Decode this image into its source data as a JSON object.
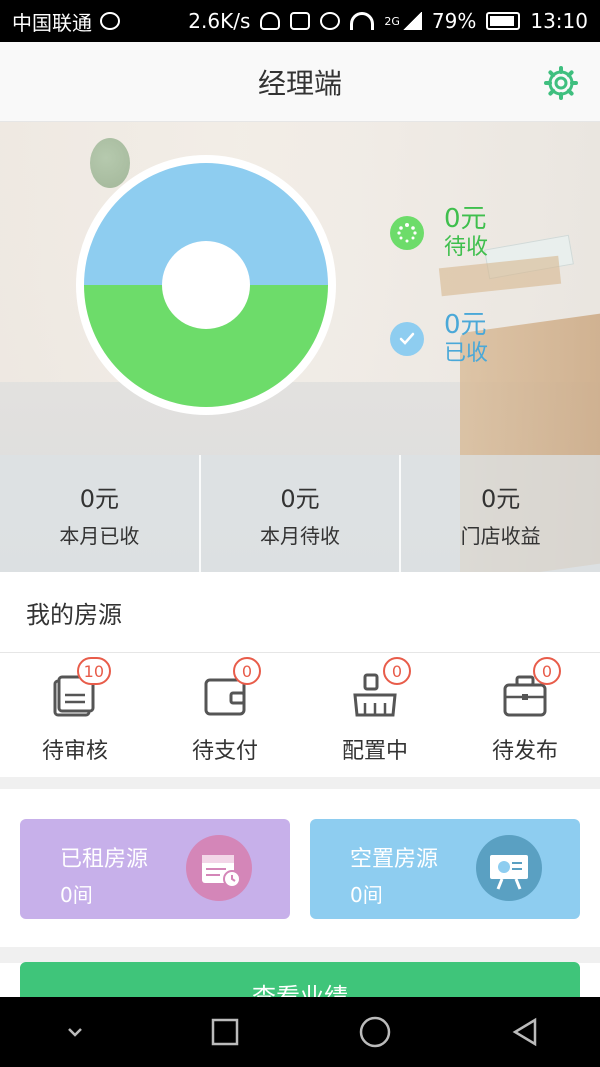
{
  "status_bar": {
    "carrier": "中国联通",
    "speed": "2.6K/s",
    "network": "2G",
    "battery": "79%",
    "time": "13:10"
  },
  "header": {
    "title": "经理端"
  },
  "summary": {
    "pending_value": "0元",
    "pending_label": "待收",
    "received_value": "0元",
    "received_label": "已收",
    "colors": {
      "pending": "#6ddc6a",
      "received": "#8ecdf0"
    }
  },
  "stats": [
    {
      "value": "0元",
      "label": "本月已收"
    },
    {
      "value": "0元",
      "label": "本月待收"
    },
    {
      "value": "0元",
      "label": "门店收益"
    }
  ],
  "section": {
    "my_listings": "我的房源"
  },
  "quick_actions": [
    {
      "label": "待审核",
      "badge": "10",
      "icon": "document-icon"
    },
    {
      "label": "待支付",
      "badge": "0",
      "icon": "wallet-icon"
    },
    {
      "label": "配置中",
      "badge": "0",
      "icon": "broom-icon"
    },
    {
      "label": "待发布",
      "badge": "0",
      "icon": "briefcase-icon"
    }
  ],
  "cards": [
    {
      "title": "已租房源",
      "count": "0间",
      "icon": "calendar-icon",
      "color": "#c7b0ea"
    },
    {
      "title": "空置房源",
      "count": "0间",
      "icon": "presentation-icon",
      "color": "#8ecdf0"
    }
  ],
  "bottom_button": {
    "label": "查看业绩"
  }
}
